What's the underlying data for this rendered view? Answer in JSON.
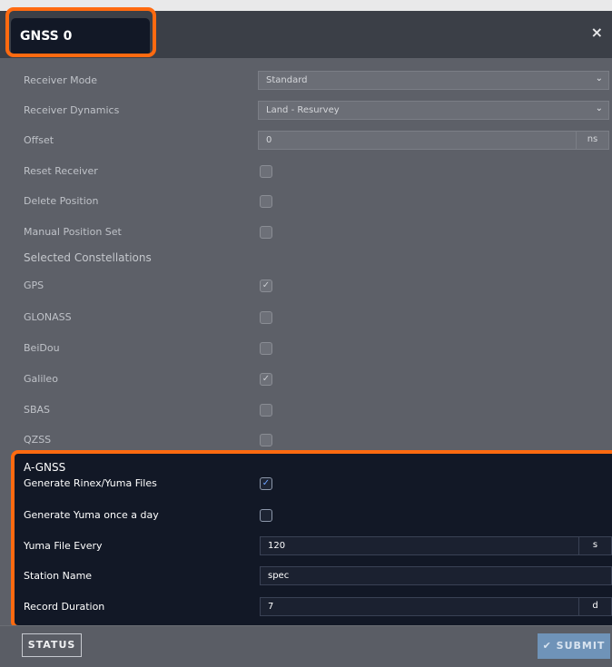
{
  "dialog": {
    "title": "GNSS 0",
    "close_glyph": "×"
  },
  "fields": {
    "receiver_mode": {
      "label": "Receiver Mode",
      "value": "Standard"
    },
    "receiver_dynamics": {
      "label": "Receiver Dynamics",
      "value": "Land - Resurvey"
    },
    "offset": {
      "label": "Offset",
      "value": "0",
      "unit": "ns"
    },
    "reset_receiver": {
      "label": "Reset Receiver",
      "checked": false
    },
    "delete_position": {
      "label": "Delete Position",
      "checked": false
    },
    "manual_position_set": {
      "label": "Manual Position Set",
      "checked": false
    }
  },
  "constellations": {
    "heading": "Selected Constellations",
    "gps": {
      "label": "GPS",
      "checked": true
    },
    "glonass": {
      "label": "GLONASS",
      "checked": false
    },
    "beidou": {
      "label": "BeiDou",
      "checked": false
    },
    "galileo": {
      "label": "Galileo",
      "checked": true
    },
    "sbas": {
      "label": "SBAS",
      "checked": false
    },
    "qzss": {
      "label": "QZSS",
      "checked": false
    }
  },
  "agnss": {
    "heading": "A-GNSS",
    "generate_rinex": {
      "label": "Generate Rinex/Yuma Files",
      "checked": true
    },
    "generate_yuma_daily": {
      "label": "Generate Yuma once a day",
      "checked": false
    },
    "yuma_file_every": {
      "label": "Yuma File Every",
      "value": "120",
      "unit": "s"
    },
    "station_name": {
      "label": "Station Name",
      "value": "spec"
    },
    "record_duration": {
      "label": "Record Duration",
      "value": "7",
      "unit": "d"
    }
  },
  "footer": {
    "status_label": "STATUS",
    "submit_label": "SUBMIT",
    "check_glyph": "✔"
  },
  "icons": {
    "checkmark": "✓",
    "chevron": "⌄"
  },
  "colors": {
    "highlight": "#ff6a10",
    "dark_panel": "#121826",
    "modal_bg": "#5d6068",
    "submit_bg": "#6f93b8"
  }
}
